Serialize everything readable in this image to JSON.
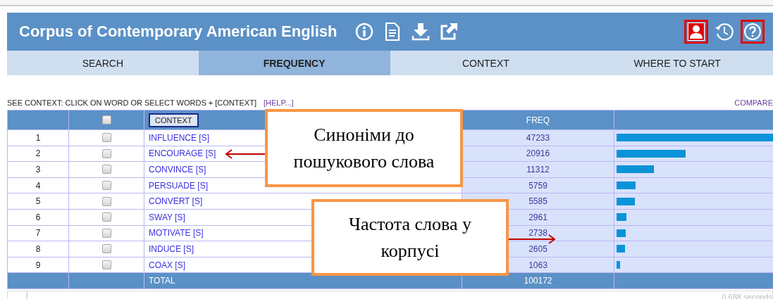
{
  "header": {
    "title": "Corpus of Contemporary American English",
    "right_icons": [
      {
        "highlighted": true
      },
      {
        "highlighted": false
      },
      {
        "highlighted": true
      }
    ]
  },
  "tabs": [
    {
      "label": "SEARCH",
      "selected": false
    },
    {
      "label": "FREQUENCY",
      "selected": true
    },
    {
      "label": "CONTEXT",
      "selected": false
    },
    {
      "label": "WHERE TO START",
      "selected": false
    }
  ],
  "hint": {
    "text": "SEE CONTEXT: CLICK ON WORD OR SELECT WORDS + [CONTEXT]",
    "help_link": "[HELP...]",
    "compare_link": "COMPARE"
  },
  "table": {
    "select_all_checked": false,
    "context_button": "CONTEXT",
    "freq_header": "FREQ",
    "rows": [
      {
        "number": "1",
        "checked": false,
        "word": "INFLUENCE [S]",
        "freq": "47233",
        "level": 1.0
      },
      {
        "number": "2",
        "checked": false,
        "word": "ENCOURAGE [S]",
        "freq": "20916",
        "level": 0.443
      },
      {
        "number": "3",
        "checked": false,
        "word": "CONVINCE [S]",
        "freq": "11312",
        "level": 0.24
      },
      {
        "number": "4",
        "checked": false,
        "word": "PERSUADE [S]",
        "freq": "5759",
        "level": 0.122
      },
      {
        "number": "5",
        "checked": false,
        "word": "CONVERT [S]",
        "freq": "5585",
        "level": 0.118
      },
      {
        "number": "6",
        "checked": false,
        "word": "SWAY [S]",
        "freq": "2961",
        "level": 0.063
      },
      {
        "number": "7",
        "checked": false,
        "word": "MOTIVATE [S]",
        "freq": "2738",
        "level": 0.058
      },
      {
        "number": "8",
        "checked": false,
        "word": "INDUCE [S]",
        "freq": "2605",
        "level": 0.055
      },
      {
        "number": "9",
        "checked": false,
        "word": "COAX [S]",
        "freq": "1063",
        "level": 0.022
      }
    ],
    "total_label": "TOTAL",
    "total_freq": "100172"
  },
  "timing": "0.688 seconds",
  "callouts": [
    {
      "text": "Синоніми до\nпошукового слова",
      "kind": "left"
    },
    {
      "text": "Частота слова у\nкорпусі",
      "kind": "right"
    }
  ]
}
